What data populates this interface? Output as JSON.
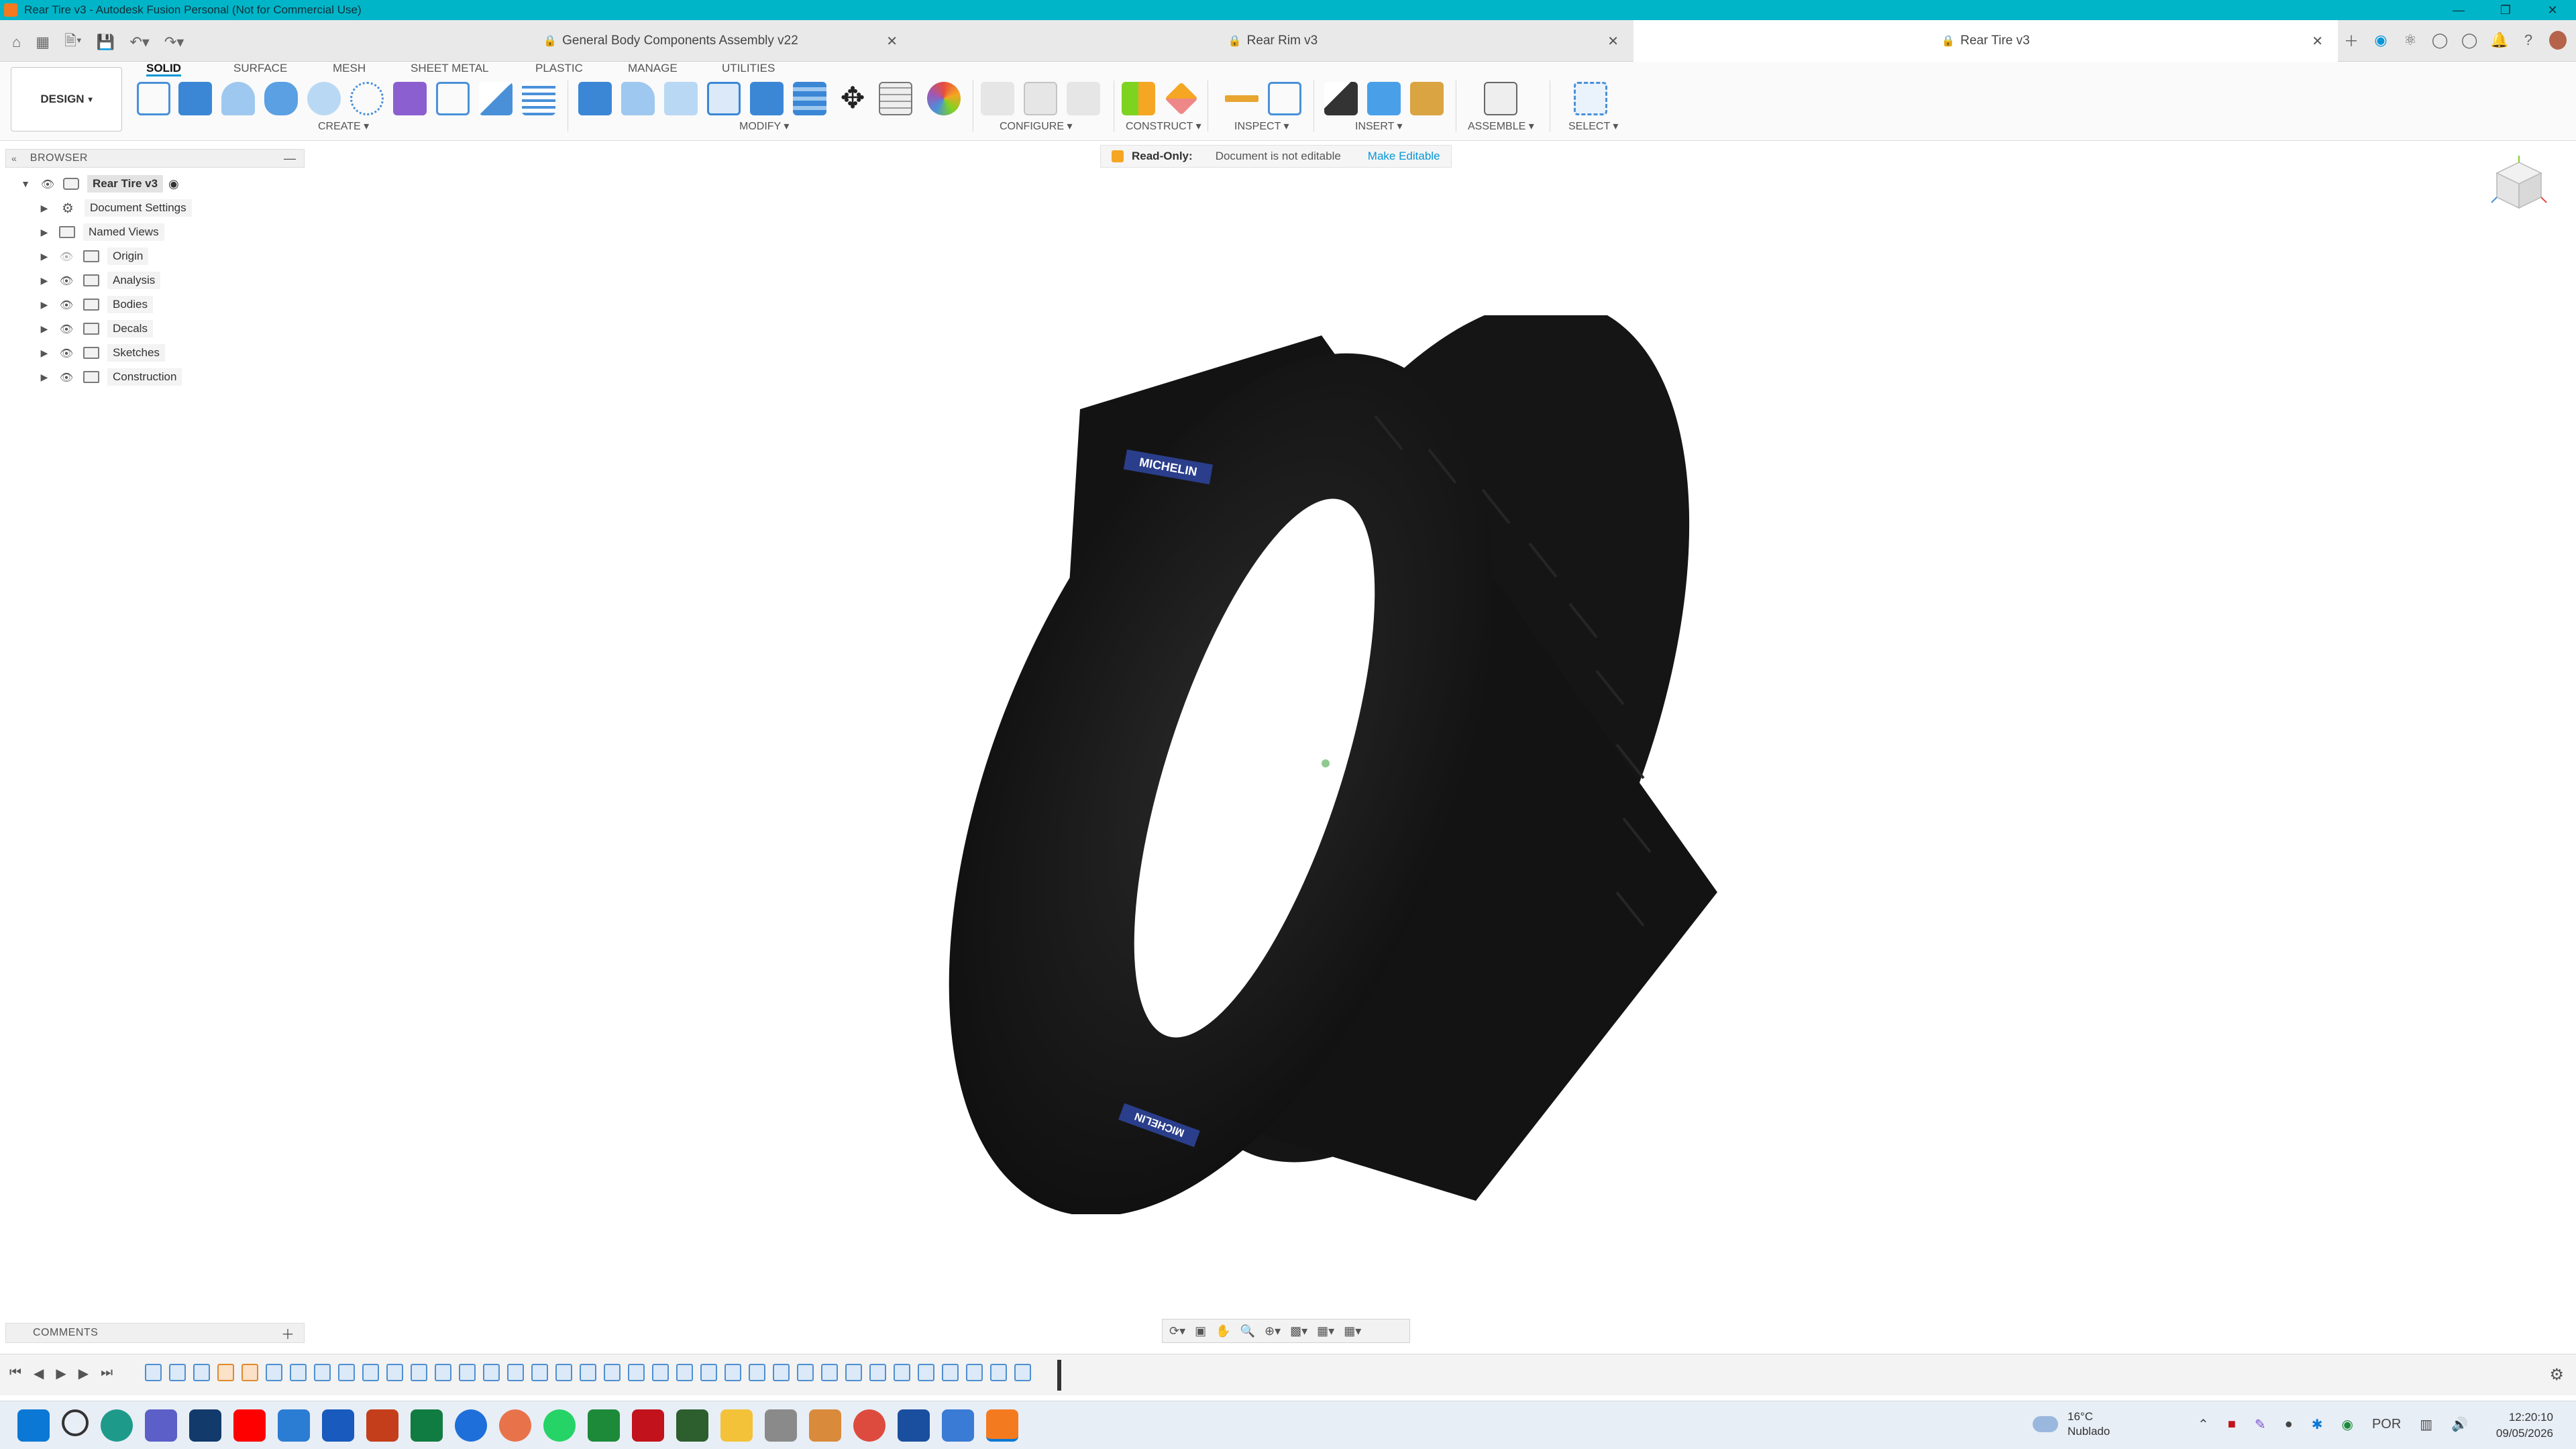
{
  "window": {
    "title": "Rear Tire v3 - Autodesk Fusion Personal (Not for Commercial Use)",
    "minimize_icon": "minimize-icon",
    "maximize_icon": "maximize-icon",
    "close_icon": "close-icon"
  },
  "tabs": [
    {
      "label": "General Body Components Assembly v22",
      "active": false
    },
    {
      "label": "Rear Rim v3",
      "active": false
    },
    {
      "label": "Rear Tire v3",
      "active": true
    }
  ],
  "workspace": {
    "mode_label": "DESIGN",
    "tabs": [
      "SOLID",
      "SURFACE",
      "MESH",
      "SHEET METAL",
      "PLASTIC",
      "MANAGE",
      "UTILITIES"
    ],
    "active_tab": "SOLID",
    "groups": [
      "CREATE",
      "MODIFY",
      "CONFIGURE",
      "CONSTRUCT",
      "INSPECT",
      "INSERT",
      "ASSEMBLE",
      "SELECT"
    ]
  },
  "readonly_banner": {
    "label": "Read-Only:",
    "message": "Document is not editable",
    "action": "Make Editable"
  },
  "browser": {
    "title": "BROWSER",
    "root": "Rear Tire v3",
    "items": [
      {
        "label": "Document Settings",
        "icon": "gear-icon"
      },
      {
        "label": "Named Views",
        "icon": "folder-icon"
      },
      {
        "label": "Origin",
        "icon": "folder-icon"
      },
      {
        "label": "Analysis",
        "icon": "folder-icon"
      },
      {
        "label": "Bodies",
        "icon": "folder-icon"
      },
      {
        "label": "Decals",
        "icon": "folder-icon"
      },
      {
        "label": "Sketches",
        "icon": "folder-icon"
      },
      {
        "label": "Construction",
        "icon": "folder-icon"
      }
    ]
  },
  "model": {
    "decal_text": "MICHELIN"
  },
  "comments": {
    "title": "COMMENTS"
  },
  "taskbar": {
    "weather_temp": "16°C",
    "weather_desc": "Nublado",
    "language": "POR",
    "time": "12:20:10",
    "date": "09/05/2026"
  },
  "colors": {
    "titlebar": "#00b5c8",
    "accent": "#0696d7",
    "tire": "#151515"
  }
}
